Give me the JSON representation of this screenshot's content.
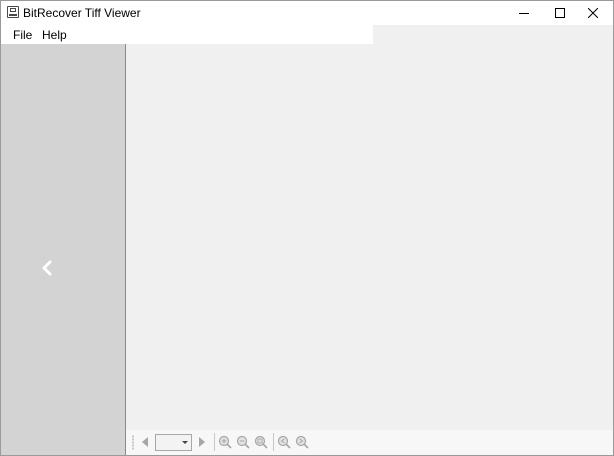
{
  "window": {
    "title": "BitRecover Tiff Viewer",
    "icon": "save-disk-icon"
  },
  "menu": {
    "items": [
      {
        "label": "File"
      },
      {
        "label": "Help"
      }
    ]
  },
  "sidebar": {
    "collapse_icon": "chevron-left-icon"
  },
  "toolbar": {
    "page_value": "",
    "buttons": [
      "previous-page-icon",
      "next-page-icon",
      "zoom-in-icon",
      "zoom-out-icon",
      "zoom-fit-icon",
      "rotate-left-icon",
      "rotate-right-icon"
    ]
  },
  "colors": {
    "sidebar": "#d3d3d3",
    "viewer": "#f0f0f0",
    "titlebar": "#ffffff"
  }
}
